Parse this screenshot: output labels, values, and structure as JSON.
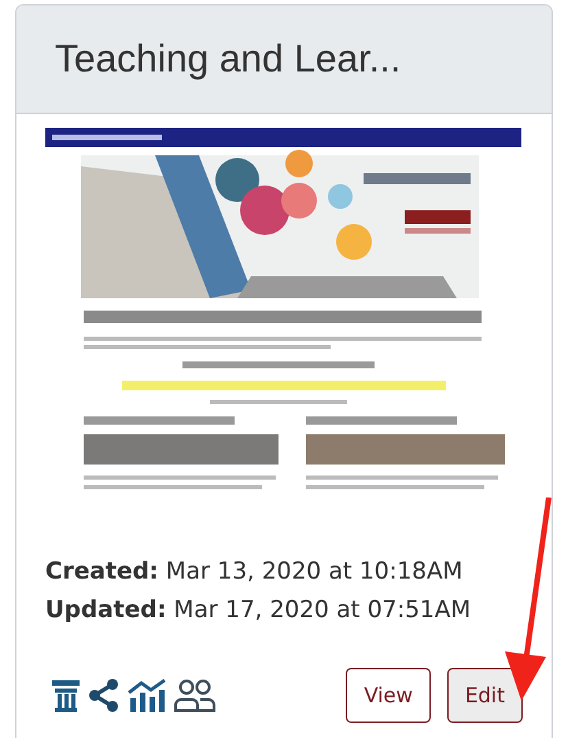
{
  "card": {
    "title": "Teaching and Lear...",
    "meta": [
      {
        "label": "Created:",
        "value": " Mar 13, 2020 at 10:18AM"
      },
      {
        "label": "Updated:",
        "value": " Mar 17, 2020 at 07:51AM"
      }
    ],
    "icons": [
      {
        "kind": "pillar"
      },
      {
        "kind": "share"
      },
      {
        "kind": "chart"
      },
      {
        "kind": "people"
      }
    ],
    "buttons": [
      {
        "label": "View",
        "selected": false
      },
      {
        "label": "Edit",
        "selected": true
      }
    ]
  }
}
